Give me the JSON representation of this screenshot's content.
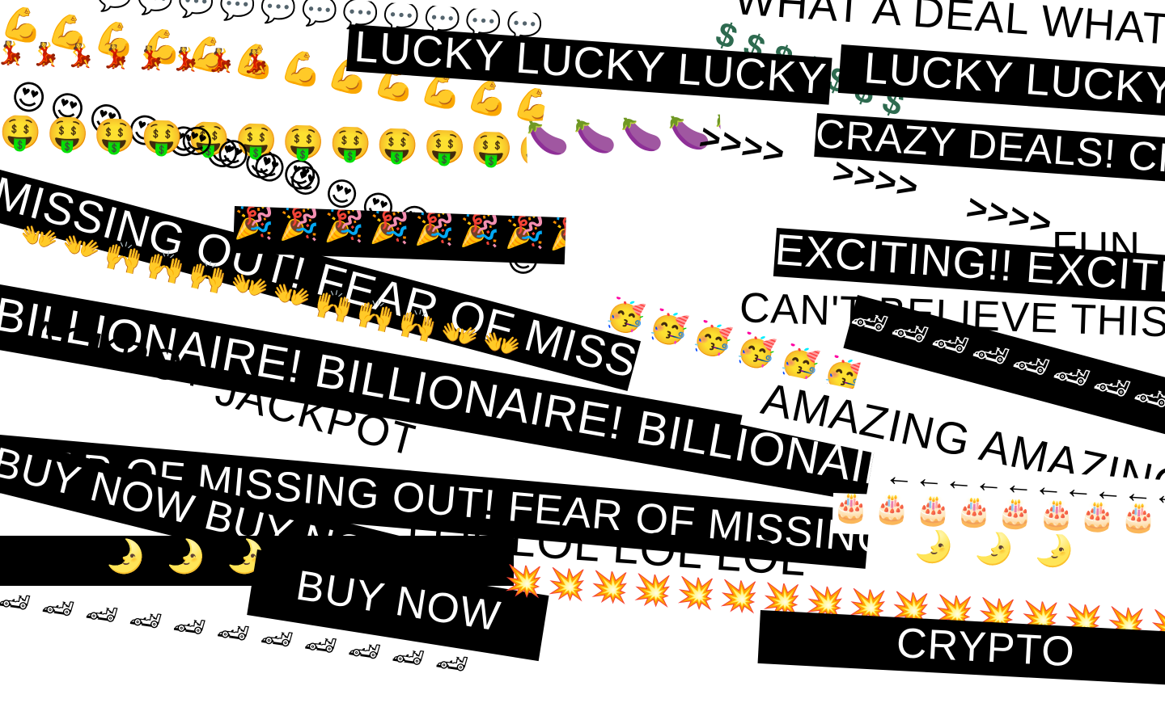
{
  "strips": [
    {
      "name": "speech-bubble-strip",
      "text": "💬💬💬💬💬💬💬💬💬💬💬💬💬",
      "style": "clear",
      "cls": "emoji"
    },
    {
      "name": "what-a-deal-strip",
      "text": "WHAT A DEAL    WHAT A DEAL",
      "style": "white",
      "cls": "txt"
    },
    {
      "name": "dollar-strip",
      "text": "$  $  $  $  $  $  $",
      "style": "clear",
      "cls": "txt"
    },
    {
      "name": "muscle-strip",
      "text": "💪💪💪💪💪💪💪💪💪💪💪💪",
      "style": "clear",
      "cls": "emoji"
    },
    {
      "name": "dancer-strip",
      "text": "💃💃💃💃💃💃💃💃",
      "style": "clear",
      "cls": "emoji"
    },
    {
      "name": "lucky-strip-1",
      "text": "LUCKY    LUCKY    LUCKY",
      "style": "black",
      "cls": "txt"
    },
    {
      "name": "lucky-strip-2",
      "text": "LUCKY    LUCKY",
      "style": "black",
      "cls": "txt"
    },
    {
      "name": "heart-eyes-strip-1",
      "text": "😍😍😍😍😍😍😍😍",
      "style": "clear",
      "cls": "emoji"
    },
    {
      "name": "money-face-strip",
      "text": "🤑🤑🤑🤑🤑🤑🤑🤑🤑🤑🤑🤑🤑",
      "style": "clear",
      "cls": "emoji"
    },
    {
      "name": "eggplant-strip",
      "text": "🍆🍆🍆🍆🍆",
      "style": "white",
      "cls": "emoji"
    },
    {
      "name": "arrows-strip-1",
      "text": ">>>>",
      "style": "clear",
      "cls": "txt"
    },
    {
      "name": "crazy-deals-strip",
      "text": "CRAZY DEALS!    CRAZY DEALS!",
      "style": "black",
      "cls": "txt"
    },
    {
      "name": "arrows-strip-2",
      "text": ">>>>",
      "style": "clear",
      "cls": "txt"
    },
    {
      "name": "arrows-strip-3",
      "text": ">>>>",
      "style": "clear",
      "cls": "txt"
    },
    {
      "name": "heart-eyes-strip-2",
      "text": "😍😍😍😍😍😍😍😍😍😍",
      "style": "clear",
      "cls": "emoji"
    },
    {
      "name": "fomo-strip-1",
      "text": "MISSING OUT!    FEAR OF MISSING OUT!",
      "style": "black",
      "cls": "txt"
    },
    {
      "name": "party-popper-strip",
      "text": "🎉🎉🎉🎉🎉🎉🎉🎉🎉🎉",
      "style": "black",
      "cls": "emoji"
    },
    {
      "name": "fun-strip",
      "text": "FUN",
      "style": "clear",
      "cls": "txt"
    },
    {
      "name": "exciting-strip",
      "text": "EXCITING!!    EXCITING!!",
      "style": "black",
      "cls": "txt"
    },
    {
      "name": "open-hands-strip",
      "text": "👐👐🙌🙌🙌👐👐🙌🙌🙌👐👐",
      "style": "clear",
      "cls": "emoji"
    },
    {
      "name": "cant-believe-strip",
      "text": "CAN'T BELIEVE THIS!    YOU",
      "style": "white",
      "cls": "txt"
    },
    {
      "name": "partying-face-strip",
      "text": "🥳🥳🥳🥳🥳🥳",
      "style": "clear",
      "cls": "emoji"
    },
    {
      "name": "race-car-strip-1",
      "text": "🏎🏎🏎🏎🏎🏎🏎🏎",
      "style": "black",
      "cls": "emoji"
    },
    {
      "name": "billionaire-strip-1",
      "text": "BILLIONAIRE!    BILLIONAIRE!    BILLIONAIRE!",
      "style": "black",
      "cls": "txt"
    },
    {
      "name": "jackpot-strip-1",
      "text": "JACKPOT",
      "style": "clear",
      "cls": "txt"
    },
    {
      "name": "amazing-strip",
      "text": "AMAZING    AMAZING",
      "style": "white",
      "cls": "txt"
    },
    {
      "name": "jackpot-strip-2",
      "text": "JACKPOT",
      "style": "clear",
      "cls": "txt"
    },
    {
      "name": "fomo-strip-2",
      "text": "FEAR OF MISSING OUT!    FEAR OF MISSING OUT",
      "style": "black",
      "cls": "txt"
    },
    {
      "name": "left-arrow-strip",
      "text": "←←←←←←←←←←",
      "style": "white",
      "cls": "txt"
    },
    {
      "name": "buy-now-strip-1",
      "text": "BUY NOW    BUY NOW",
      "style": "black",
      "cls": "txt"
    },
    {
      "name": "birthday-cake-strip",
      "text": "🎂🎂🎂🎂🎂🎂🎂🎂🎂🎂",
      "style": "white",
      "cls": "emoji"
    },
    {
      "name": "lol-strip",
      "text": "LOL    LOL    LOL    LOL",
      "style": "clear",
      "cls": "txt"
    },
    {
      "name": "crescent-moon-strip-1",
      "text": "🌛        🌛        🌛",
      "style": "black",
      "cls": "emoji"
    },
    {
      "name": "crescent-moon-strip-2",
      "text": "🌛        🌛        🌛",
      "style": "white",
      "cls": "emoji"
    },
    {
      "name": "buy-now-strip-2",
      "text": "BUY NOW",
      "style": "black",
      "cls": "txt"
    },
    {
      "name": "collision-strip",
      "text": "💥💥💥💥💥💥💥💥💥💥💥💥💥💥💥💥",
      "style": "clear",
      "cls": "emoji"
    },
    {
      "name": "race-car-strip-2",
      "text": "🏎🏎🏎🏎🏎🏎🏎🏎🏎🏎🏎",
      "style": "clear",
      "cls": "emoji"
    },
    {
      "name": "crypto-strip",
      "text": "CRYPTO",
      "style": "black",
      "cls": "txt"
    }
  ]
}
